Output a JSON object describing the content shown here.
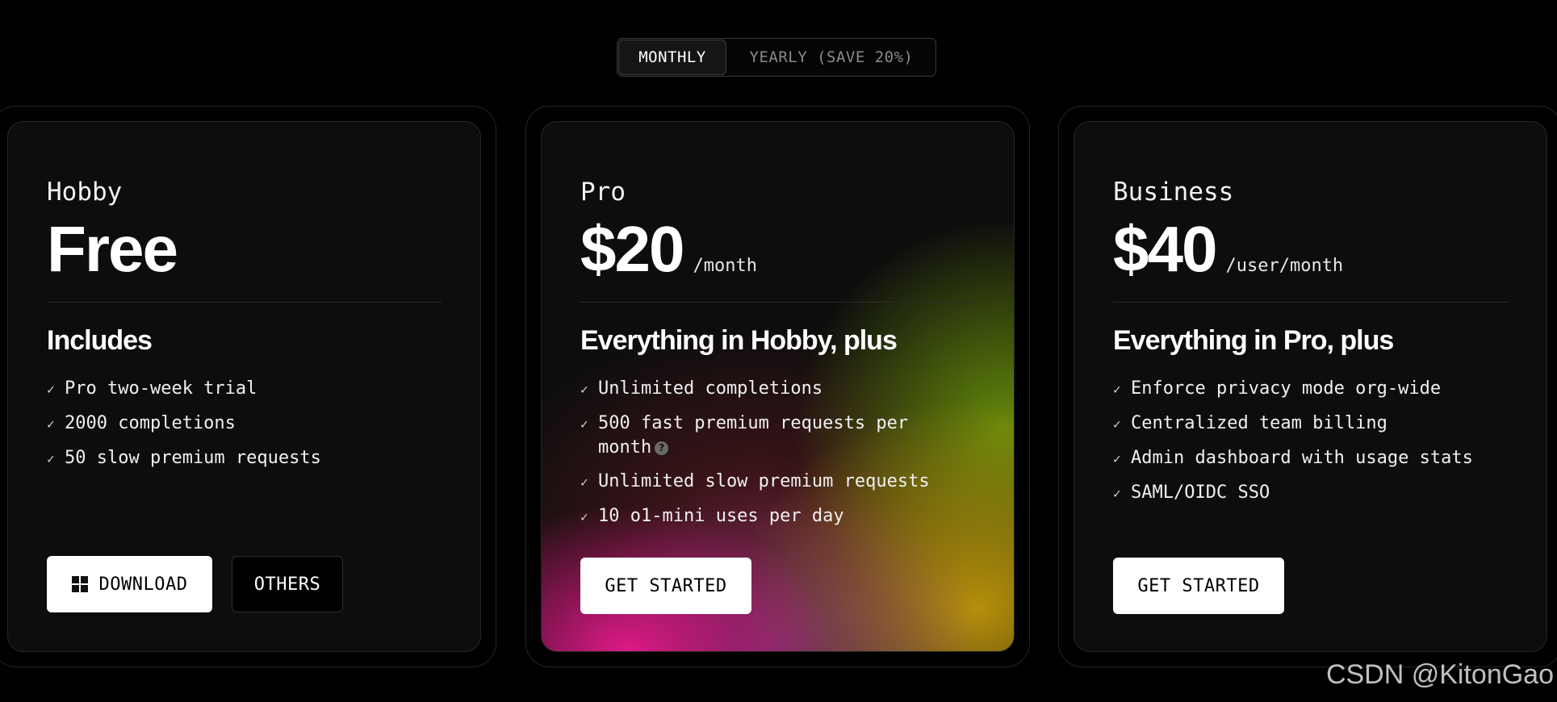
{
  "billing_toggle": {
    "monthly_label": "MONTHLY",
    "yearly_label": "YEARLY (SAVE 20%)"
  },
  "plans": [
    {
      "name": "Hobby",
      "price": "Free",
      "period": "",
      "section_title": "Includes",
      "features": [
        "Pro two-week trial",
        "2000 completions",
        "50 slow premium requests"
      ],
      "buttons": {
        "download_label": "DOWNLOAD",
        "others_label": "OTHERS"
      }
    },
    {
      "name": "Pro",
      "price": "$20",
      "period": "/month",
      "section_title": "Everything in Hobby, plus",
      "features": [
        "Unlimited completions",
        "500 fast premium requests per month",
        "Unlimited slow premium requests",
        "10 o1-mini uses per day"
      ],
      "info_icon_symbol": "?",
      "buttons": {
        "get_started_label": "GET STARTED"
      }
    },
    {
      "name": "Business",
      "price": "$40",
      "period": "/user/month",
      "section_title": "Everything in Pro, plus",
      "features": [
        "Enforce privacy mode org-wide",
        "Centralized team billing",
        "Admin dashboard with usage stats",
        "SAML/OIDC SSO"
      ],
      "buttons": {
        "get_started_label": "GET STARTED"
      }
    }
  ],
  "check_symbol": "✓",
  "watermark": "CSDN @KitonGao",
  "icons": {
    "download": "windows-logo-icon",
    "info": "help-circle-icon",
    "feature": "check-icon"
  },
  "colors": {
    "background": "#000000",
    "card": "#0d0d0d",
    "button_light": "#ffffff",
    "gradient_pink": "#e6198c",
    "gradient_gold": "#be960a",
    "gradient_green": "#6e960a"
  }
}
